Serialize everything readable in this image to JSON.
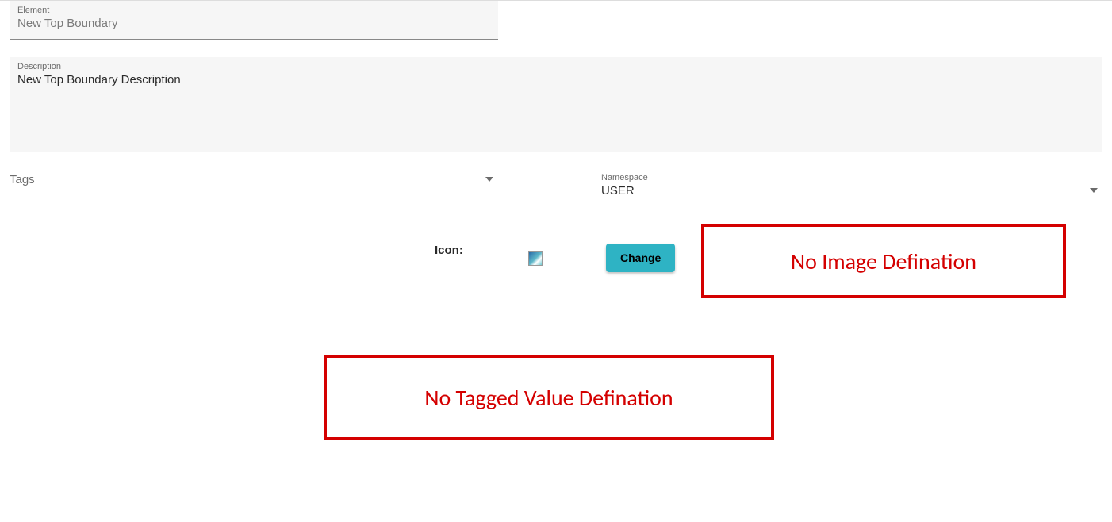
{
  "element": {
    "label": "Element",
    "value": "New Top Boundary"
  },
  "description": {
    "label": "Description",
    "value": "New Top Boundary Description"
  },
  "tags": {
    "placeholder": "Tags"
  },
  "namespace": {
    "label": "Namespace",
    "value": "USER"
  },
  "icon": {
    "label": "Icon:",
    "change_button": "Change"
  },
  "annotations": {
    "no_image": "No Image Defination",
    "no_tagged_value": "No Tagged Value Defination"
  }
}
